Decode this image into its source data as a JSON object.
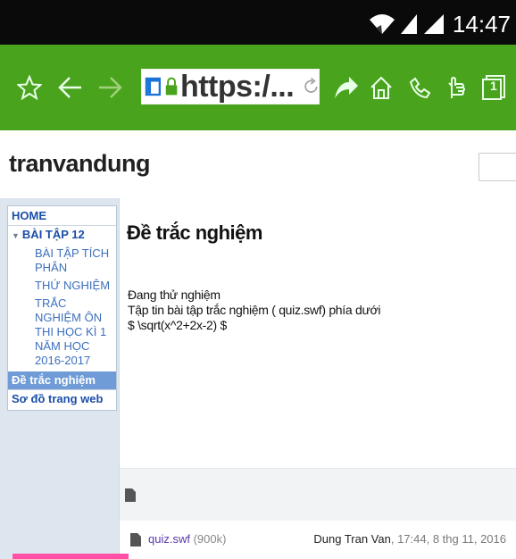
{
  "status_bar": {
    "time": "14:47",
    "icons": [
      "wifi-icon",
      "signal-icon",
      "signal-icon-2"
    ]
  },
  "browser": {
    "url": "https:/...",
    "icons": [
      "star-icon",
      "back-icon",
      "forward-icon",
      "tab-icon",
      "lock-icon",
      "reload-icon",
      "share-icon",
      "home-icon",
      "voice-icon",
      "hand-icon",
      "tabs-count-icon"
    ],
    "tabs_count": "1"
  },
  "site": {
    "title": "tranvandung"
  },
  "sidebar": {
    "home": "HOME",
    "section": "BÀI TẬP 12",
    "items": [
      "BÀI TẬP TÍCH PHÂN",
      "THỨ NGHIỆM",
      "TRẮC NGHIỆM ÔN THI HỌC KÌ 1 NĂM HỌC 2016-2017"
    ],
    "selected": "Đề trắc nghiệm",
    "sitemap": "Sơ đồ trang web"
  },
  "main": {
    "title": "Đề trắc nghiệm",
    "lines": [
      "Đang thử nghiệm",
      "Tập tin bài tập trắc nghiệm  ( quiz.swf) phía dưới",
      "$ \\sqrt(x^2+2x-2) $"
    ]
  },
  "attachment": {
    "name": "quiz.swf",
    "size": "(900k)",
    "author": "Dung Tran Van",
    "date": ", 17:44, 8 thg 11, 2016"
  },
  "colors": {
    "toolbar": "#4aa31d",
    "statusbar": "#0a0a0a",
    "selected_nav": "#6f9bd6",
    "link": "#2a5db0"
  }
}
